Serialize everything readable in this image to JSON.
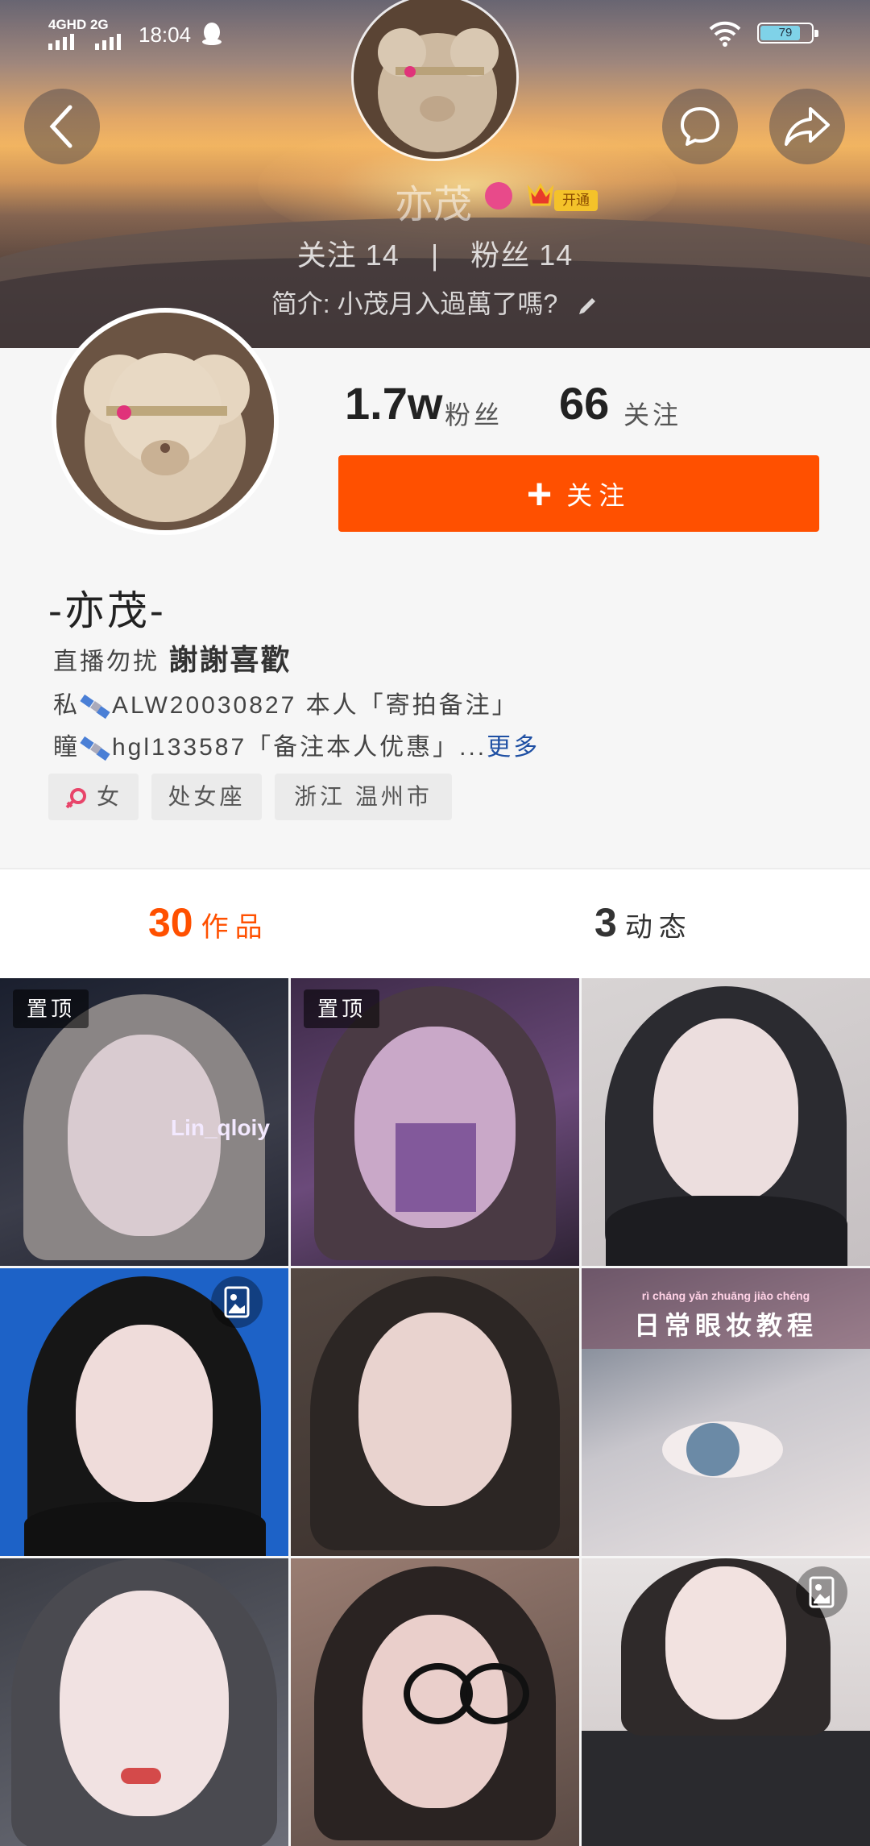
{
  "status_bar": {
    "network": "4GHD 2G",
    "time": "18:04",
    "battery": "79",
    "battery_level": 0.79
  },
  "header": {
    "username_ghost": "亦茂",
    "vip_label": "开通",
    "follow_label": "关注",
    "follow_count": "14",
    "separator": "|",
    "fans_label": "粉丝",
    "fans_count": "14",
    "bio_prefix": "简介:",
    "bio_text": "小茂月入過萬了嗎?"
  },
  "icons": {
    "back": "back-icon",
    "message": "message-icon",
    "share": "share-icon",
    "edit": "pencil-icon"
  },
  "profile": {
    "fans_count": "1.7w",
    "fans_label": "粉丝",
    "following_count": "66",
    "following_label": "关注",
    "follow_button_plus": "+",
    "follow_button_label": "关注",
    "nickname": "-亦茂-",
    "bio_line1_a": "直播勿扰",
    "bio_line1_b": "謝謝喜歡",
    "bio_line2_prefix": "私",
    "bio_line2_text": "ALW20030827 本人「寄拍备注」",
    "bio_line3_prefix": "瞳",
    "bio_line3_text": "hgl133587「备注本人优惠」...",
    "bio_more": "更多",
    "tags": [
      "女",
      "处女座",
      "浙江 温州市"
    ]
  },
  "tabs": [
    {
      "count": "30",
      "label": "作品",
      "active": true
    },
    {
      "count": "3",
      "label": "动态",
      "active": false
    }
  ],
  "grid": {
    "pinned_label": "置顶",
    "cell1_watermark": "Lin_qloiy",
    "cell6_caption": "日常眼妆教程",
    "cell6_pinyin": "rì cháng yǎn zhuāng jiào chéng"
  },
  "colors": {
    "accent": "#ff5000",
    "link": "#1e4fa3",
    "tag_bg": "#ebebeb"
  }
}
